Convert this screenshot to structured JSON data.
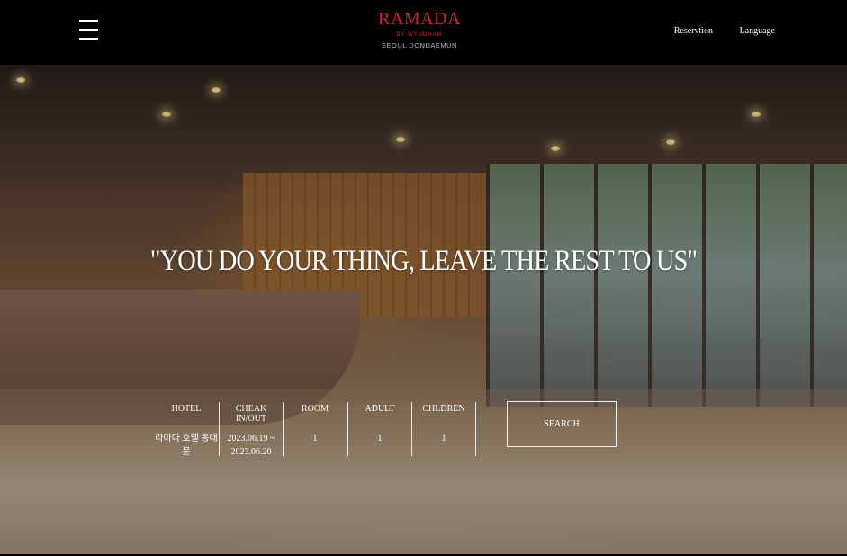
{
  "header": {
    "brand": "RAMADA",
    "brand_sub": "BY WYNDHAM",
    "location": "SEOUL DONDAEMUN",
    "nav": [
      "Reservtion",
      "Language"
    ]
  },
  "hero": {
    "tagline": "\"YOU DO YOUR THING, LEAVE THE REST TO US\""
  },
  "booking": {
    "fields": [
      {
        "label": "HOTEL",
        "value": "라마다 호텔 동대문"
      },
      {
        "label": "CHEAK IN/OUT",
        "value": "2023.06.19 ~",
        "value2": "2023.06.20"
      },
      {
        "label": "ROOM",
        "value": "1"
      },
      {
        "label": "ADULT",
        "value": "1"
      },
      {
        "label": "CHLDREN",
        "value": "1"
      }
    ],
    "search_label": "SEARCH"
  },
  "colors": {
    "brand_red": "#d8202f",
    "header_bg": "#000000"
  },
  "icons": [
    "menu-icon"
  ]
}
